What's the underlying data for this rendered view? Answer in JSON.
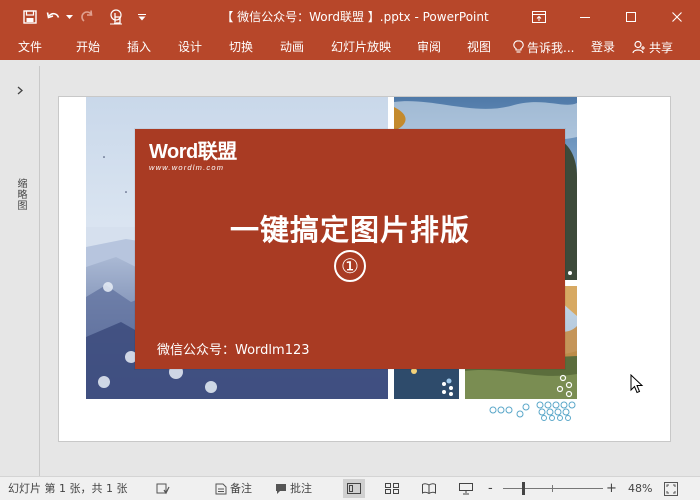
{
  "app": {
    "title": "【 微信公众号：Word联盟 】.pptx - PowerPoint",
    "accent_color": "#b7472a"
  },
  "quick_access": {
    "icons": [
      "save-icon",
      "undo-icon",
      "undo-dropdown-icon",
      "redo-icon",
      "touch-mode-icon",
      "customize-qat-icon"
    ]
  },
  "window_controls": {
    "icons": [
      "ribbon-display-options-icon",
      "minimize-icon",
      "maximize-icon",
      "close-icon"
    ]
  },
  "ribbon": {
    "tabs": [
      {
        "label": "文件"
      },
      {
        "label": "开始"
      },
      {
        "label": "插入"
      },
      {
        "label": "设计"
      },
      {
        "label": "切换"
      },
      {
        "label": "动画"
      },
      {
        "label": "幻灯片放映"
      },
      {
        "label": "审阅"
      },
      {
        "label": "视图"
      }
    ],
    "tell_me": "告诉我...",
    "login": "登录",
    "share": "共享"
  },
  "thumbnail_pane": {
    "label": "缩略图"
  },
  "slide": {
    "logo_main": "Word联盟",
    "logo_sub": "www.wordlm.com",
    "headline": "一键搞定图片排版",
    "number": "①",
    "subtitle": "微信公众号：Wordlm123",
    "banner_color": "#a93b23"
  },
  "status_bar": {
    "slide_info": "幻灯片 第 1 张，共 1 张",
    "notes": "备注",
    "comments": "批注",
    "zoom_out": "-",
    "zoom_in": "+",
    "zoom": "48%"
  }
}
